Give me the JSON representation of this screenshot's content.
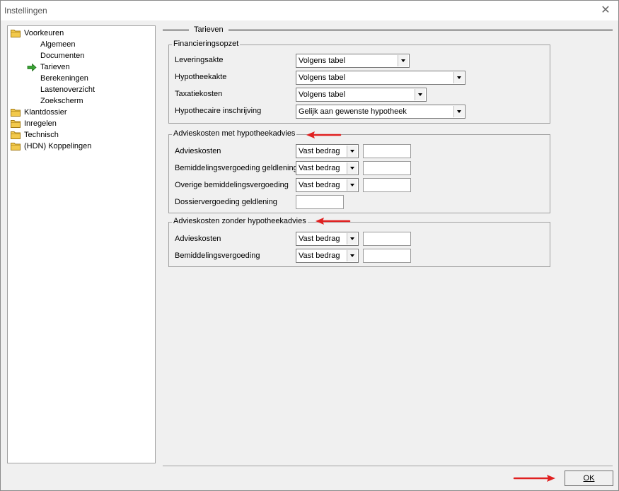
{
  "window": {
    "title": "Instellingen",
    "close_icon": "close-icon"
  },
  "tree": {
    "items": [
      {
        "label": "Voorkeuren",
        "icon": "folder-icon"
      },
      {
        "label": "Algemeen"
      },
      {
        "label": "Documenten"
      },
      {
        "label": "Tarieven",
        "icon": "green-arrow-icon",
        "selected": true
      },
      {
        "label": "Berekeningen"
      },
      {
        "label": "Lastenoverzicht"
      },
      {
        "label": "Zoekscherm"
      },
      {
        "label": "Klantdossier",
        "icon": "folder-icon"
      },
      {
        "label": "Inregelen",
        "icon": "folder-icon"
      },
      {
        "label": "Technisch",
        "icon": "folder-icon"
      },
      {
        "label": "(HDN) Koppelingen",
        "icon": "folder-icon"
      }
    ]
  },
  "main": {
    "section_title": "Tarieven",
    "financiering": {
      "legend": "Financieringsopzet",
      "rows": [
        {
          "label": "Leveringsakte",
          "value": "Volgens tabel"
        },
        {
          "label": "Hypotheekakte",
          "value": "Volgens tabel"
        },
        {
          "label": "Taxatiekosten",
          "value": "Volgens tabel"
        },
        {
          "label": "Hypothecaire inschrijving",
          "value": "Gelijk aan gewenste hypotheek"
        }
      ]
    },
    "met_advies": {
      "legend": "Advieskosten met hypotheekadvies",
      "rows": [
        {
          "label": "Advieskosten",
          "value": "Vast bedrag",
          "amount": ""
        },
        {
          "label": "Bemiddelingsvergoeding geldlening",
          "value": "Vast bedrag",
          "amount": ""
        },
        {
          "label": "Overige bemiddelingsvergoeding",
          "value": "Vast bedrag",
          "amount": ""
        },
        {
          "label": "Dossiervergoeding geldlening",
          "amount": ""
        }
      ]
    },
    "zonder_advies": {
      "legend": "Advieskosten zonder hypotheekadvies",
      "rows": [
        {
          "label": "Advieskosten",
          "value": "Vast bedrag",
          "amount": ""
        },
        {
          "label": "Bemiddelingsvergoeding",
          "value": "Vast bedrag",
          "amount": ""
        }
      ]
    }
  },
  "footer": {
    "ok_label": "OK"
  },
  "colors": {
    "annotation_arrow": "#e02020",
    "tree_arrow": "#3aa335",
    "folder": "#f2c94c"
  }
}
